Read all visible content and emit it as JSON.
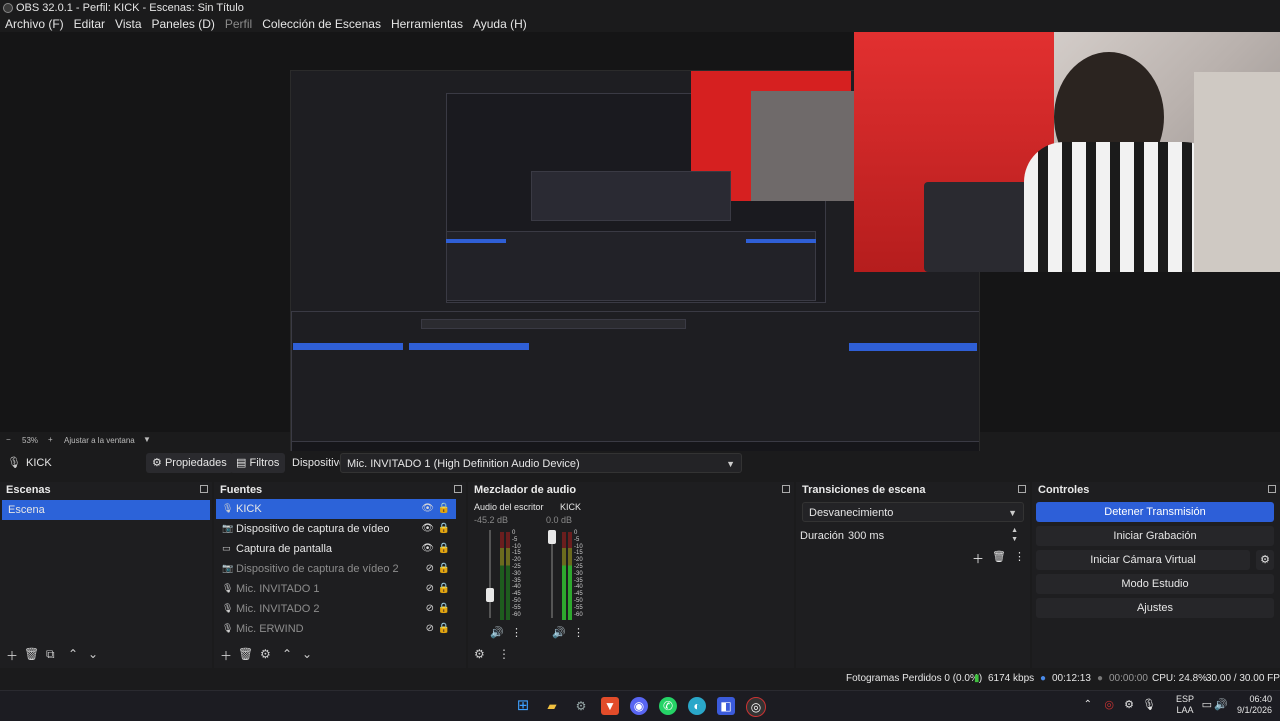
{
  "window": {
    "title": "OBS 32.0.1 - Perfil: KICK - Escenas: Sin Título"
  },
  "menu": [
    "Archivo (F)",
    "Editar",
    "Vista",
    "Paneles (D)",
    "Perfil",
    "Colección de Escenas",
    "Herramientas",
    "Ayuda (H)"
  ],
  "zoom": {
    "value": "53%",
    "fit_label": "Ajustar a la ventana"
  },
  "source_toolbar": {
    "current_source": "KICK",
    "properties_label": "Propiedades",
    "filters_label": "Filtros",
    "device_label": "Dispositivo",
    "device_value": "Mic. INVITADO 1 (High Definition Audio Device)"
  },
  "scenes": {
    "title": "Escenas",
    "items": [
      {
        "label": "Escena",
        "selected": true
      }
    ]
  },
  "sources": {
    "title": "Fuentes",
    "items": [
      {
        "label": "KICK",
        "icon": "mic-icon",
        "selected": true,
        "visible": true,
        "dim": false
      },
      {
        "label": "Dispositivo de captura de vídeo",
        "icon": "camera-icon",
        "selected": false,
        "visible": true,
        "dim": false
      },
      {
        "label": "Captura de pantalla",
        "icon": "monitor-icon",
        "selected": false,
        "visible": true,
        "dim": false
      },
      {
        "label": "Dispositivo de captura de vídeo 2",
        "icon": "camera-icon",
        "selected": false,
        "visible": false,
        "dim": true
      },
      {
        "label": "Mic. INVITADO 1",
        "icon": "mic-icon",
        "selected": false,
        "visible": false,
        "dim": true
      },
      {
        "label": "Mic. INVITADO 2",
        "icon": "mic-icon",
        "selected": false,
        "visible": false,
        "dim": true
      },
      {
        "label": "Mic. ERWIND",
        "icon": "mic-icon",
        "selected": false,
        "visible": false,
        "dim": true
      }
    ]
  },
  "mixer": {
    "title": "Mezclador de audio",
    "channels": [
      {
        "name": "Audio del escritorio",
        "db": "-45.2 dB",
        "level": 0.1
      },
      {
        "name": "KICK",
        "db": "0.0 dB",
        "level": 0.55
      }
    ],
    "scale": [
      "0",
      "-5",
      "-10",
      "-15",
      "-20",
      "-25",
      "-30",
      "-35",
      "-40",
      "-45",
      "-50",
      "-55",
      "-60"
    ]
  },
  "transitions": {
    "title": "Transiciones de escena",
    "selected": "Desvanecimiento",
    "duration_label": "Duración",
    "duration_value": "300 ms"
  },
  "controls": {
    "title": "Controles",
    "stop_stream": "Detener Transmisión",
    "start_recording": "Iniciar Grabación",
    "virtual_cam": "Iniciar Cámara Virtual",
    "studio_mode": "Modo Estudio",
    "settings": "Ajustes"
  },
  "status": {
    "dropped_frames": "Fotogramas Perdidos 0 (0.0%)",
    "bitrate": "6174 kbps",
    "stream_time": "00:12:13",
    "rec_time": "00:00:00",
    "cpu": "CPU: 24.8%",
    "fps": "30.00 / 30.00 FPS"
  },
  "taskbar": {
    "lang": "ESP",
    "lang_sub": "LAA",
    "time": "06:40",
    "date": "9/1/2026"
  },
  "colors": {
    "accent": "#2d5fd8",
    "background": "#1e1e20"
  }
}
